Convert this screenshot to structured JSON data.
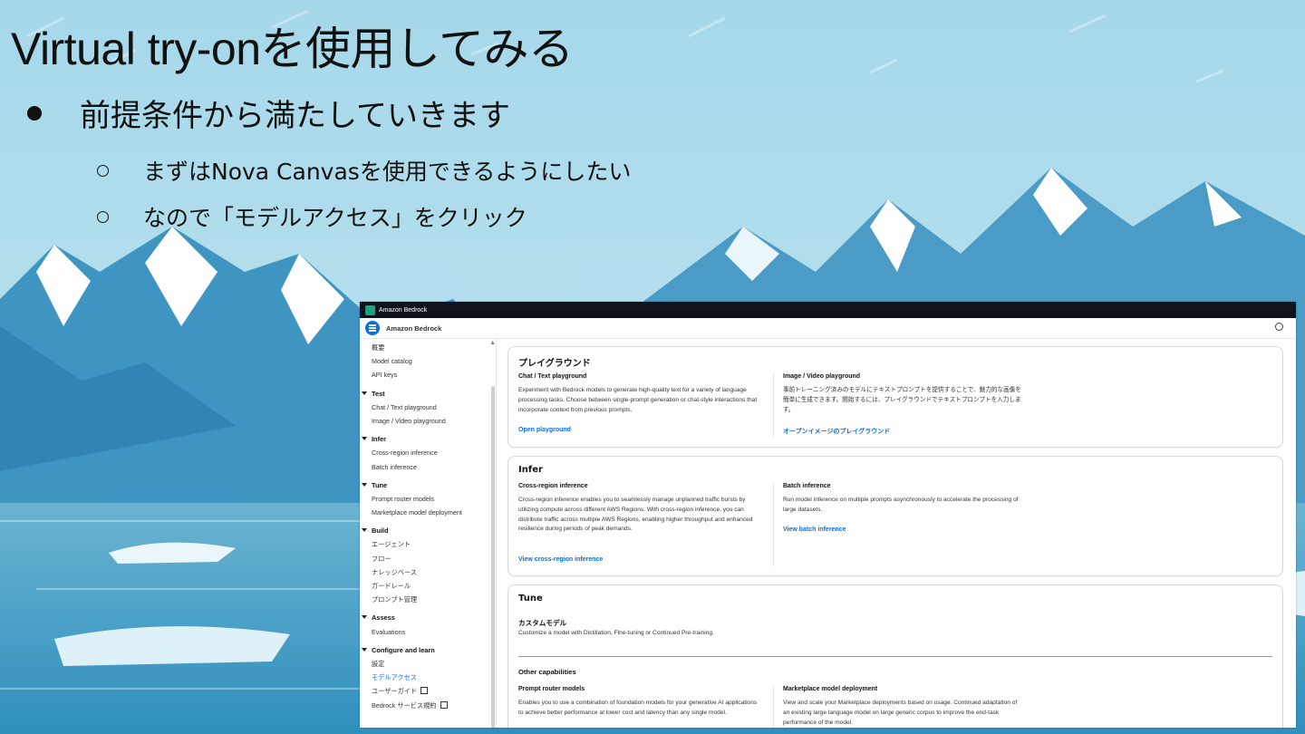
{
  "slide": {
    "title": "Virtual try-onを使用してみる",
    "bullet": "前提条件から満たしていきます",
    "sub_bullets": [
      "まずはNova Canvasを使用できるようにしたい",
      "なので「モデルアクセス」をクリック"
    ]
  },
  "console": {
    "top_brand": "Amazon Bedrock",
    "service_name": "Amazon Bedrock",
    "nav": {
      "top_items": [
        "概要",
        "Model catalog",
        "API keys"
      ],
      "groups": [
        {
          "label": "Test",
          "items": [
            "Chat / Text playground",
            "Image / Video playground"
          ]
        },
        {
          "label": "Infer",
          "items": [
            "Cross-region inference",
            "Batch inference"
          ]
        },
        {
          "label": "Tune",
          "items": [
            "Prompt router models",
            "Marketplace model deployment"
          ]
        },
        {
          "label": "Build",
          "items": [
            "エージェント",
            "フロー",
            "ナレッジベース",
            "ガードレール",
            "プロンプト管理"
          ]
        },
        {
          "label": "Assess",
          "items": [
            "Evaluations"
          ]
        },
        {
          "label": "Configure and learn",
          "items": [
            "設定",
            "モデルアクセス",
            "ユーザーガイド",
            "Bedrock サービス規約"
          ]
        }
      ]
    },
    "playground_card": {
      "title": "プレイグラウンド",
      "left_heading": "Chat / Text playground",
      "left_text": "Experiment with Bedrock models to generate high-quality text for a variety of language processing tasks. Choose between single-prompt generation or chat-style interactions that incorporate context from previous prompts.",
      "left_link": "Open playground",
      "right_heading": "Image / Video playground",
      "right_text": "事前トレーニング済みのモデルにテキストプロンプトを提供することで、魅力的な画像を簡単に生成できます。開始するには、プレイグラウンドでテキストプロンプトを入力します。",
      "right_link": "オープンイメージのプレイグラウンド"
    },
    "infer_card": {
      "title": "Infer",
      "left_heading": "Cross-region inference",
      "left_text": "Cross-region inference enables you to seamlessly manage unplanned traffic bursts by utilizing compute across different AWS Regions. With cross-region inference, you can distribute traffic across multiple AWS Regions, enabling higher throughput and enhanced resilience during periods of peak demands.",
      "left_link": "View cross-region inference",
      "right_heading": "Batch inference",
      "right_text": "Run model inference on multiple prompts asynchronously to accelerate the processing of large datasets.",
      "right_link": "View batch inference"
    },
    "tune_card": {
      "title": "Tune",
      "custom_heading": "カスタムモデル",
      "custom_text": "Customize a model with Distillation, Fine-tuning or Continued Pre-training.",
      "other_heading": "Other capabilities",
      "left_heading": "Prompt router models",
      "left_text": "Enables you to use a combination of foundation models for your generative AI applications to achieve better performance at lower cost and latency than any single model.",
      "right_heading": "Marketplace model deployment",
      "right_text": "View and scale your Marketplace deployments based on usage. Continued adaptation of an existing large language model on large generic corpus to improve the end-task performance of the model."
    }
  }
}
